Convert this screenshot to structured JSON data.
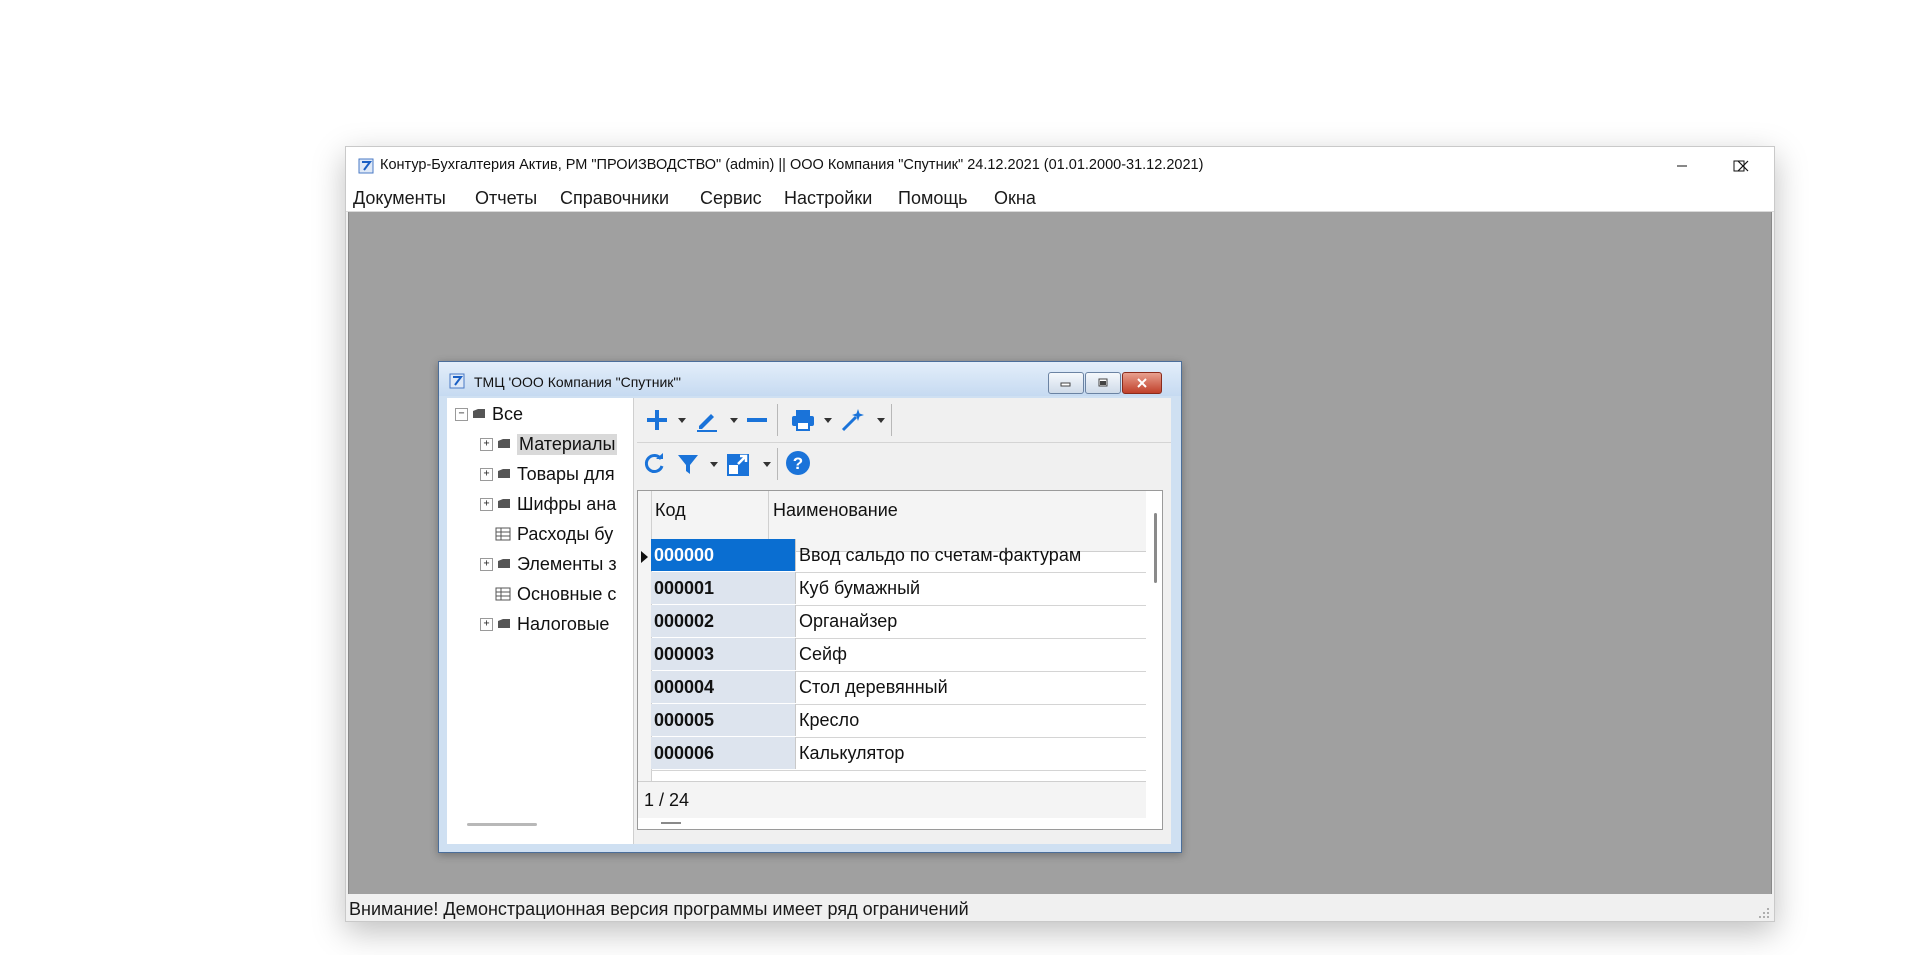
{
  "app": {
    "title": "Контур-Бухгалтерия Актив, РМ \"ПРОИЗВОДСТВО\" (admin) || ООО Компания \"Спутник\" 24.12.2021 (01.01.2000-31.12.2021)",
    "menu": [
      "Документы",
      "Отчеты",
      "Справочники",
      "Сервис",
      "Настройки",
      "Помощь",
      "Окна"
    ],
    "status_message": "Внимание! Демонстрационная версия программы имеет ряд ограничений"
  },
  "child_window": {
    "title": "ТМЦ  'ООО Компания \"Спутник\"'",
    "tree": {
      "root": "Все",
      "items": [
        {
          "label": "Материалы",
          "type": "folder",
          "expandable": true,
          "selected": true
        },
        {
          "label": "Товары для",
          "type": "folder",
          "expandable": true,
          "selected": false
        },
        {
          "label": "Шифры ана",
          "type": "folder",
          "expandable": true,
          "selected": false
        },
        {
          "label": "Расходы бу",
          "type": "table",
          "expandable": false,
          "selected": false
        },
        {
          "label": "Элементы з",
          "type": "folder",
          "expandable": true,
          "selected": false
        },
        {
          "label": "Основные с",
          "type": "table",
          "expandable": false,
          "selected": false
        },
        {
          "label": "Налоговые",
          "type": "folder",
          "expandable": true,
          "selected": false
        }
      ]
    },
    "toolbar": {
      "row1": [
        "add-icon",
        "edit-icon",
        "delete-icon",
        "print-icon",
        "magic-wand-icon"
      ],
      "row2": [
        "refresh-icon",
        "filter-icon",
        "export-icon",
        "help-icon"
      ]
    },
    "grid": {
      "columns": [
        "Код",
        "Наименование"
      ],
      "rows": [
        {
          "code": "000000",
          "name": "Ввод сальдо по счетам-фактурам"
        },
        {
          "code": "000001",
          "name": "Куб бумажный"
        },
        {
          "code": "000002",
          "name": "Органайзер"
        },
        {
          "code": "000003",
          "name": "Сейф"
        },
        {
          "code": "000004",
          "name": "Стол деревянный"
        },
        {
          "code": "000005",
          "name": "Кресло"
        },
        {
          "code": "000006",
          "name": "Калькулятор"
        }
      ],
      "counter": "1 / 24"
    }
  },
  "colors": {
    "accent": "#1a73d9",
    "selection": "#0a6ed1",
    "workspace": "#a0a0a0"
  }
}
